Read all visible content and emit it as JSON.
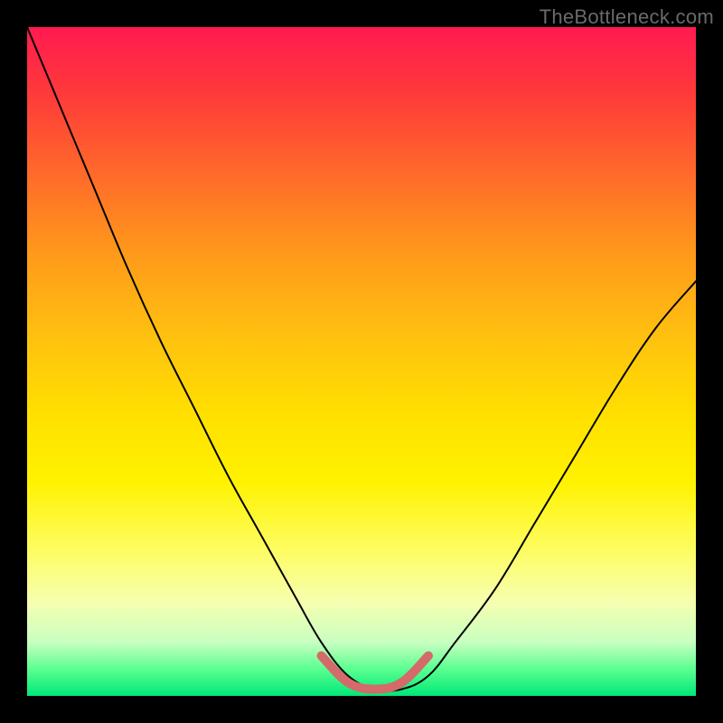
{
  "watermark": "TheBottleneck.com",
  "chart_data": {
    "type": "line",
    "title": "",
    "xlabel": "",
    "ylabel": "",
    "xlim": [
      0,
      100
    ],
    "ylim": [
      0,
      100
    ],
    "legend": false,
    "grid": false,
    "background": "heatmap-gradient",
    "gradient_stops": [
      {
        "pos": 0.0,
        "color": "#ff1a50"
      },
      {
        "pos": 0.1,
        "color": "#ff3a3a"
      },
      {
        "pos": 0.22,
        "color": "#ff6a2a"
      },
      {
        "pos": 0.34,
        "color": "#ff9a1a"
      },
      {
        "pos": 0.46,
        "color": "#ffc010"
      },
      {
        "pos": 0.58,
        "color": "#ffe000"
      },
      {
        "pos": 0.68,
        "color": "#fff200"
      },
      {
        "pos": 0.78,
        "color": "#fdfd60"
      },
      {
        "pos": 0.86,
        "color": "#f6ffb0"
      },
      {
        "pos": 0.92,
        "color": "#c8ffc0"
      },
      {
        "pos": 0.96,
        "color": "#5aff90"
      },
      {
        "pos": 1.0,
        "color": "#00e878"
      }
    ],
    "series": [
      {
        "name": "bottleneck-curve",
        "color": "#000000",
        "stroke_width": 2,
        "x": [
          0,
          5,
          10,
          15,
          20,
          25,
          30,
          35,
          40,
          44,
          48,
          52,
          56,
          60,
          64,
          70,
          76,
          82,
          88,
          94,
          100
        ],
        "y": [
          100,
          88,
          76,
          64,
          53,
          43,
          33,
          24,
          15,
          8,
          3,
          1,
          1,
          3,
          8,
          16,
          26,
          36,
          46,
          55,
          62
        ]
      },
      {
        "name": "optimal-range",
        "color": "#d46a6a",
        "stroke_width": 10,
        "x": [
          44,
          48,
          52,
          56,
          60
        ],
        "y": [
          6,
          2,
          1,
          2,
          6
        ]
      }
    ],
    "annotations": []
  }
}
